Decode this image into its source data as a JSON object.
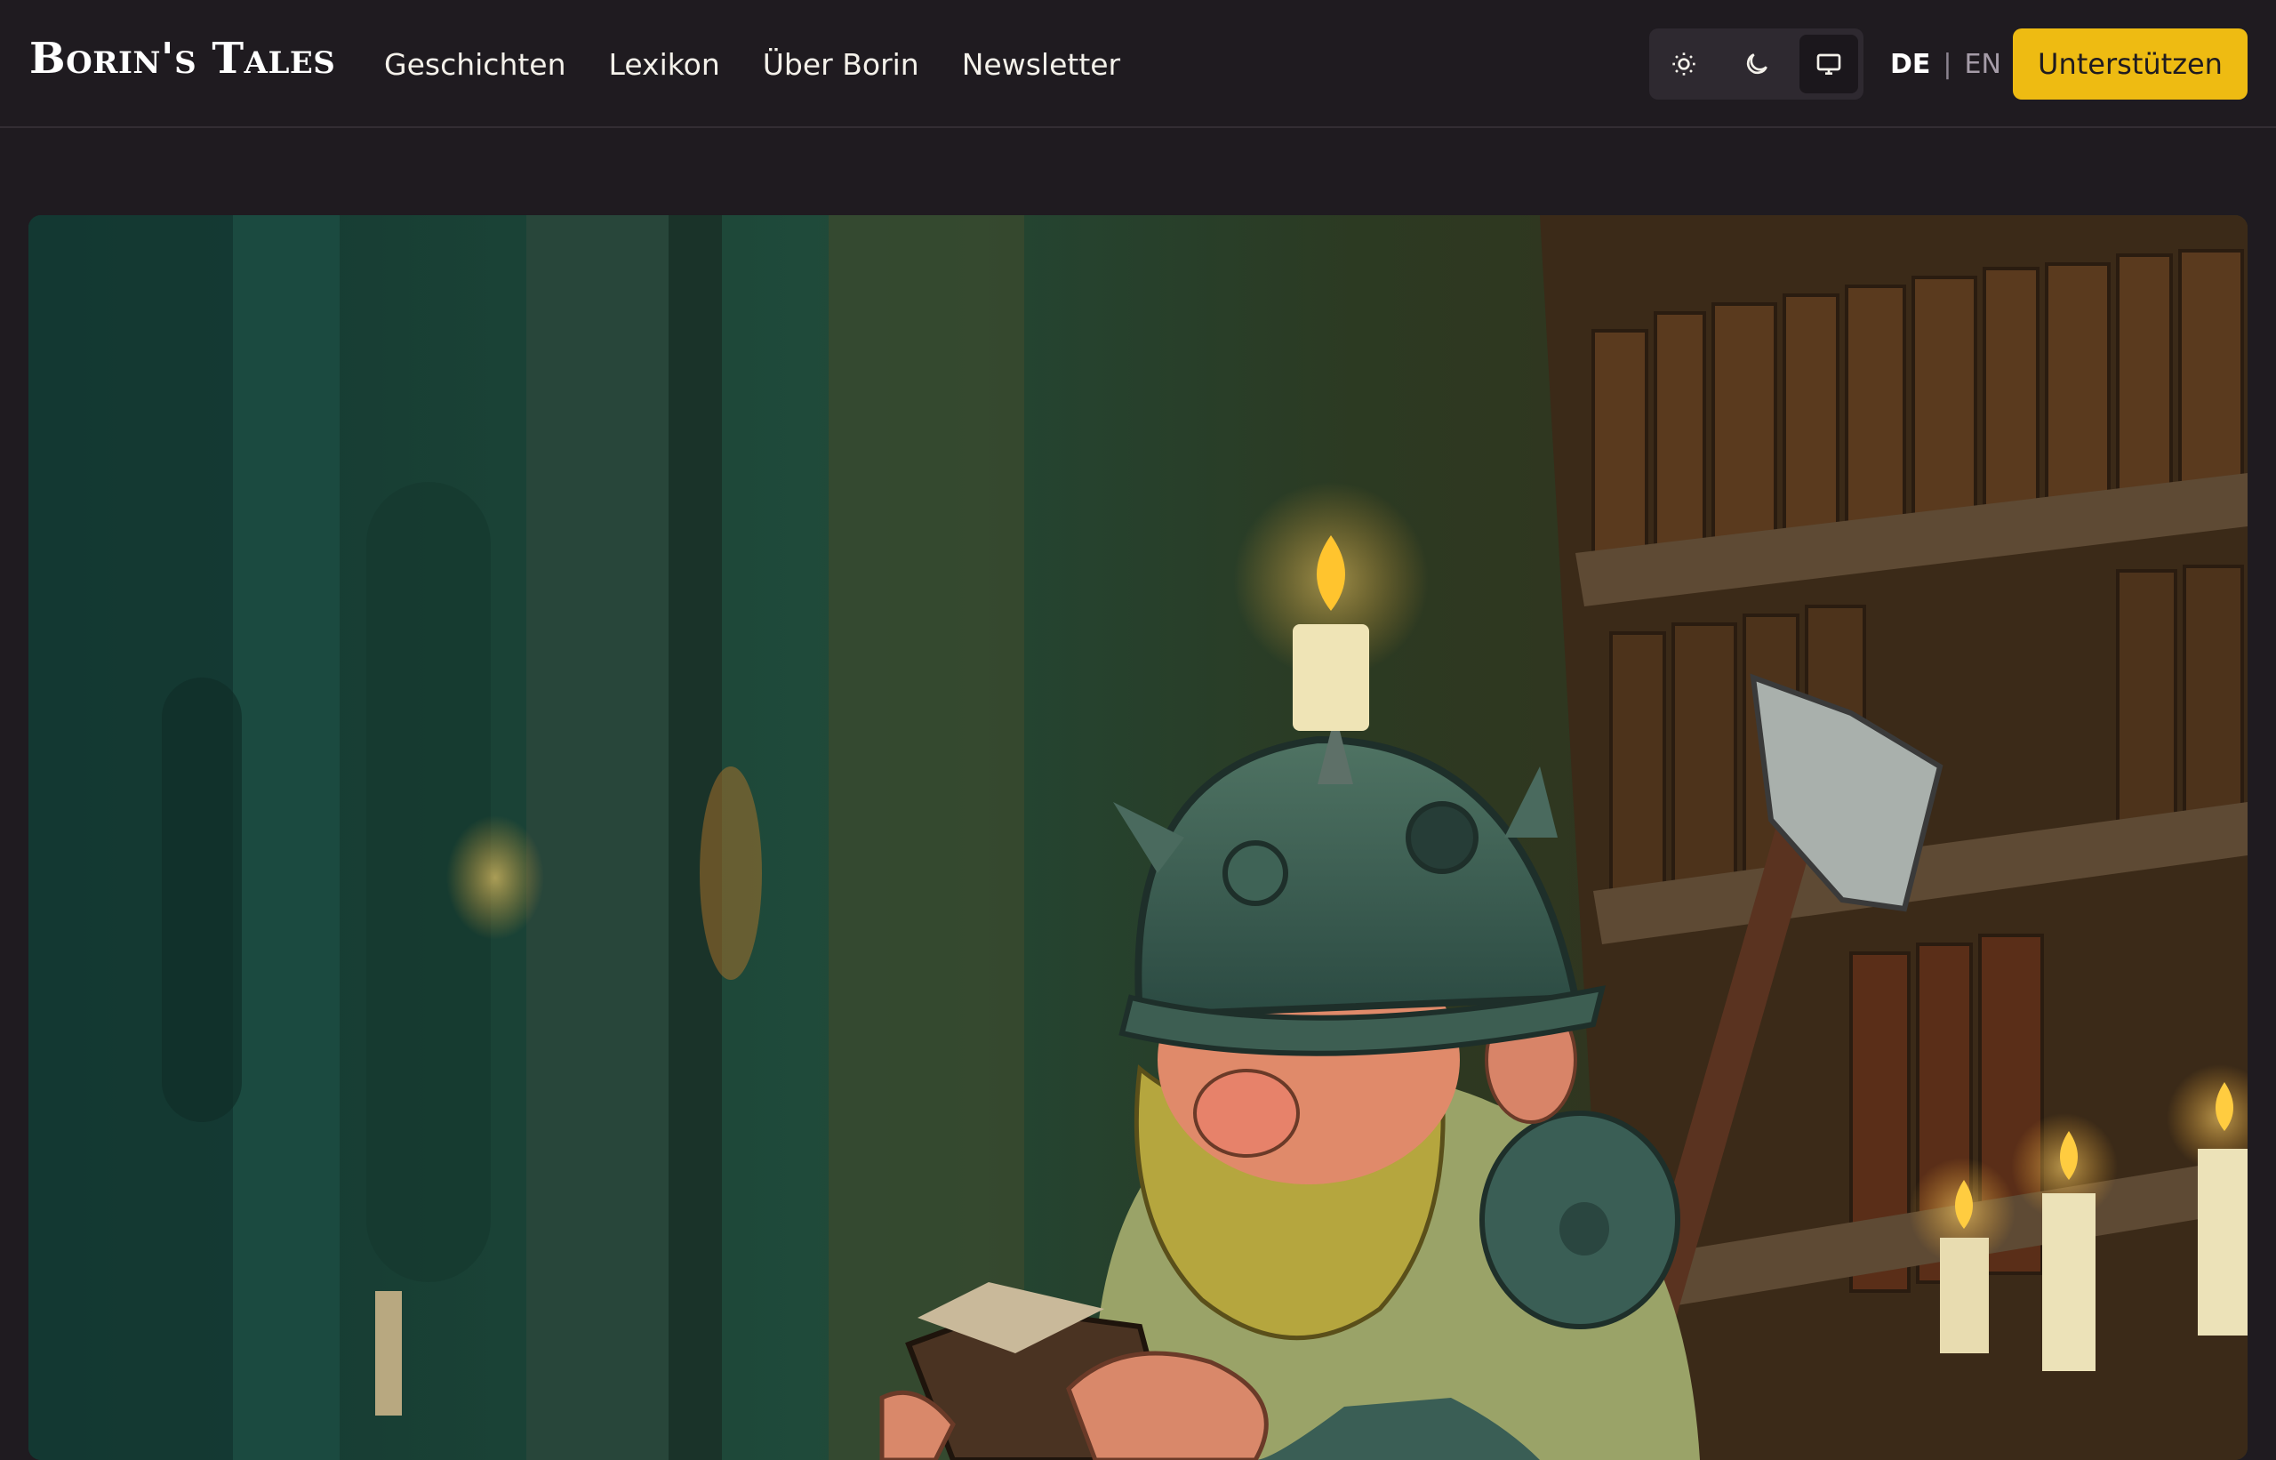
{
  "header": {
    "logo": "Borin's Tales",
    "nav": [
      {
        "label": "Geschichten"
      },
      {
        "label": "Lexikon"
      },
      {
        "label": "Über Borin"
      },
      {
        "label": "Newsletter"
      }
    ],
    "theme_options": [
      {
        "icon": "sun-icon",
        "active": false
      },
      {
        "icon": "moon-icon",
        "active": false
      },
      {
        "icon": "monitor-icon",
        "active": true
      }
    ],
    "languages": {
      "active": "DE",
      "separator": "|",
      "inactive": "EN"
    },
    "cta_label": "Unterstützen"
  },
  "colors": {
    "background": "#1f1b20",
    "accent": "#eebb12",
    "text": "#f4f1ea"
  },
  "hero": {
    "image": "dwarf-reading-book-illustration"
  }
}
